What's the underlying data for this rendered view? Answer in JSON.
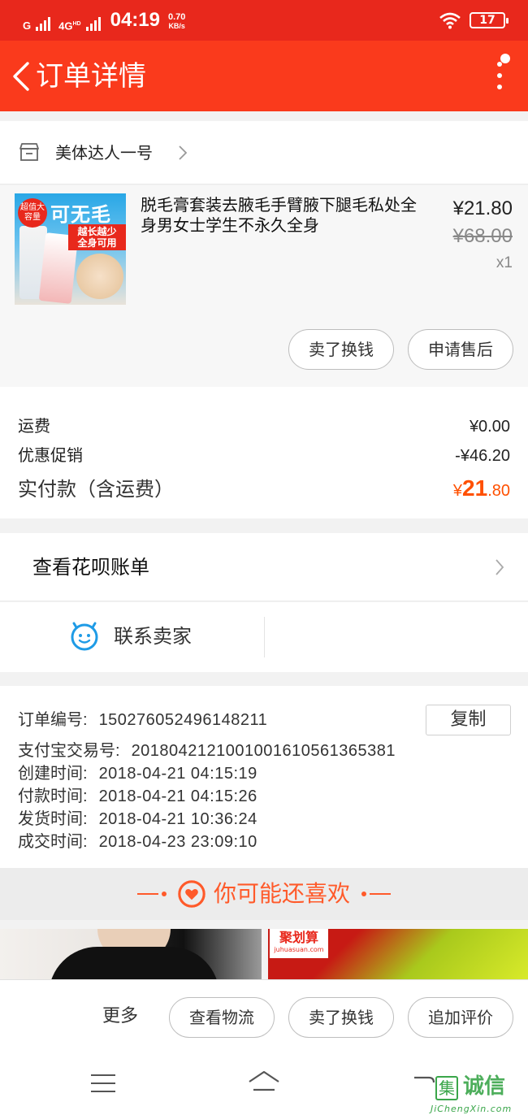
{
  "status_bar": {
    "signal1_label": "G",
    "signal2_label": "4G",
    "signal2_sup": "HD",
    "time": "04:19",
    "net_speed_value": "0.70",
    "net_speed_unit": "KB/s",
    "battery": "17"
  },
  "nav": {
    "title": "订单详情"
  },
  "shop": {
    "name": "美体达人一号"
  },
  "product": {
    "title": "脱毛膏套装去腋毛手臂腋下腿毛私处全身男女士学生不永久全身",
    "price": "¥21.80",
    "original_price": "¥68.00",
    "quantity": "x1",
    "thumb_badge": "超值大容量",
    "thumb_headline": "可无毛",
    "thumb_tag": "越长越少 全身可用",
    "actions": [
      "卖了换钱",
      "申请售后"
    ]
  },
  "costs": {
    "shipping_label": "运费",
    "shipping_value": "¥0.00",
    "discount_label": "优惠促销",
    "discount_value": "-¥46.20",
    "total_label": "实付款（含运费）",
    "total_currency": "¥",
    "total_int": "21",
    "total_dec": ".80"
  },
  "huabei": {
    "label": "查看花呗账单"
  },
  "contact": {
    "label": "联系卖家"
  },
  "order_info": {
    "copy_label": "复制",
    "rows": [
      {
        "label": "订单编号:",
        "value": "150276052496148211"
      },
      {
        "label": "支付宝交易号:",
        "value": "2018042121001001610561365381"
      },
      {
        "label": "创建时间:",
        "value": "2018-04-21 04:15:19"
      },
      {
        "label": "付款时间:",
        "value": "2018-04-21 04:15:26"
      },
      {
        "label": "发货时间:",
        "value": "2018-04-21 10:36:24"
      },
      {
        "label": "成交时间:",
        "value": "2018-04-23 23:09:10"
      }
    ]
  },
  "recommend": {
    "title": "你可能还喜欢",
    "banner2_logo": "聚划算",
    "banner2_url": "juhuasuan.com"
  },
  "bottom_bar": {
    "more_label": "更多",
    "buttons": [
      "查看物流",
      "卖了换钱",
      "追加评价"
    ]
  },
  "watermark": {
    "box_char": "集",
    "text": "诚信",
    "url": "JiChengXin.com"
  },
  "colors": {
    "status_bar": "#e8281c",
    "nav_bar": "#fa3a1c",
    "accent_orange": "#ff5000",
    "contact_blue": "#1e9be6"
  }
}
